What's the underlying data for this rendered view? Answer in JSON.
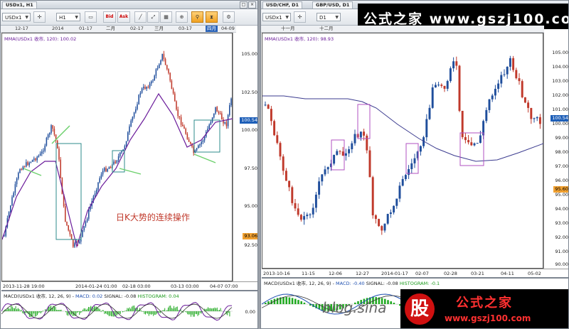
{
  "left_pane": {
    "tab_label": "USDx1, H1",
    "symbol": "USDx1",
    "timeframe": "H1",
    "bid_label": "Bid",
    "ask_label": "Ask",
    "time_labels": [
      "12-17",
      "2014",
      "01-17",
      "二月",
      "02-17",
      "三月",
      "03-17",
      "四月",
      "04-09"
    ],
    "highlight_time": "四月",
    "ma_label": "MMA(USDx1 收市, 120): 100.02",
    "y_ticks": [
      "105.00",
      "102.50",
      "100.00",
      "97.50",
      "95.00",
      "92.50"
    ],
    "price_tag": "100.54",
    "low_tag": "93.06",
    "x_ticks": [
      "2013-11-28 19:00",
      "2014-01-24 01:00",
      "02-18 03:00",
      "03-13 03:00",
      "04-07 07:00"
    ],
    "annotation": "日K大势的连续操作",
    "macd_label": {
      "title": "MACD(USDx1 收市, 12, 26, 9) - ",
      "macd": "MACD: 0.02",
      "signal": "SIGNAL: -0.08",
      "histogram": "HISTOGRAM: 0.04"
    },
    "macd_tick": "0.00"
  },
  "right_pane": {
    "tabs": [
      "USD/CHF, D1",
      "GBP/USD, D1"
    ],
    "symbol": "USDx1",
    "timeframe": "D1",
    "time_labels": [
      "十一月",
      "十二月"
    ],
    "ma_label": "MMA(USDx1 收市, 120): 98.93",
    "y_ticks": [
      "105.00",
      "104.00",
      "103.00",
      "102.00",
      "101.00",
      "100.00",
      "99.00",
      "98.00",
      "97.00",
      "96.00",
      "95.00",
      "94.00",
      "93.00",
      "92.00",
      "91.00",
      "90.00"
    ],
    "price_tag": "100.54",
    "low_tag": "95.60",
    "x_ticks": [
      "2013-10-16",
      "11-15",
      "12-06",
      "12-27",
      "2014-01-17",
      "02-07",
      "02-28",
      "03-21",
      "04-11",
      "05-02"
    ],
    "macd_label": {
      "title": "MACD(USDx1 收市, 12, 26, 9) - ",
      "macd": "MACD: -0.40",
      "signal": "SIGNAL: -0.08",
      "histogram": "HISTOGRAM: -0.1"
    }
  },
  "branding": {
    "top_banner": "公式之家 www.gszj100.com",
    "bottom_banner_title": "公式之家",
    "bottom_banner_url": "www.gszj100.com",
    "bottom_banner_char": "股",
    "watermark": "blog.sina"
  },
  "colors": {
    "up": "#1f4e9c",
    "down": "#c0392b",
    "ma": "#6a1b9a",
    "macd_hist": "#22aa22",
    "box_teal": "#2e8b8b",
    "box_purple": "#b050c0",
    "arrow_green": "#6bd06b",
    "price_tag_bg": "#1e5fb8",
    "low_tag_bg": "#f0a030"
  }
}
